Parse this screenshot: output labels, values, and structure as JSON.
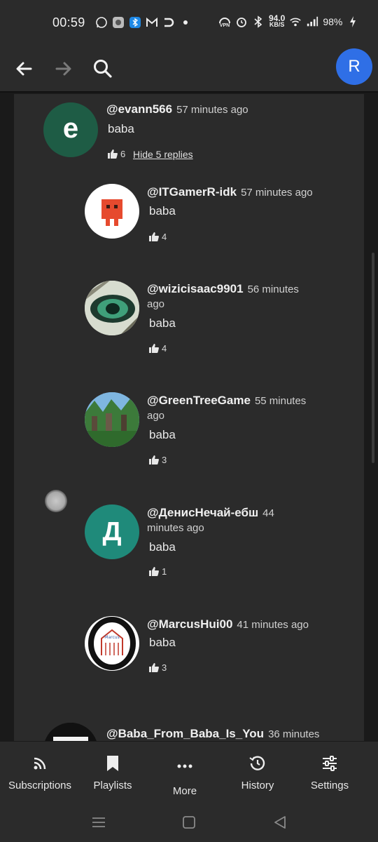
{
  "status_bar": {
    "time": "00:59",
    "net_speed_value": "94.0",
    "net_speed_unit": "KB/S",
    "battery": "98%",
    "vpn_label": "VPN"
  },
  "header": {
    "profile_initial": "R"
  },
  "comment": {
    "author": "@evann566",
    "time": "57 minutes ago",
    "text": "baba",
    "avatar_letter": "e",
    "likes": "6",
    "hide_replies_label": "Hide 5 replies"
  },
  "replies": [
    {
      "author": "@ITGamerR-idk",
      "time": "57 minutes ago",
      "text": "baba",
      "likes": "4"
    },
    {
      "author": "@wizicisaac9901",
      "time_part1": "56 minutes",
      "time_part2": "ago",
      "text": "baba",
      "likes": "4"
    },
    {
      "author": "@GreenTreeGame",
      "time_part1": "55 minutes",
      "time_part2": "ago",
      "text": "baba",
      "likes": "3"
    },
    {
      "author": "@ДенисНечай-ебш",
      "time_part1": "44",
      "time_part2": "minutes ago",
      "text": "baba",
      "likes": "1",
      "avatar_letter": "Д"
    },
    {
      "author": "@MarcusHui00",
      "time": "41 minutes ago",
      "text": "baba",
      "likes": "3"
    }
  ],
  "next_comment": {
    "author": "@Baba_From_Baba_Is_You",
    "time": "36 minutes"
  },
  "bottom_nav": {
    "subscriptions": "Subscriptions",
    "playlists": "Playlists",
    "more": "More",
    "history": "History",
    "settings": "Settings"
  },
  "colors": {
    "background": "#2b2b2b",
    "profile_accent": "#2f6fe6",
    "evann_avatar": "#1e5c45",
    "denis_avatar": "#1f8a7a"
  }
}
